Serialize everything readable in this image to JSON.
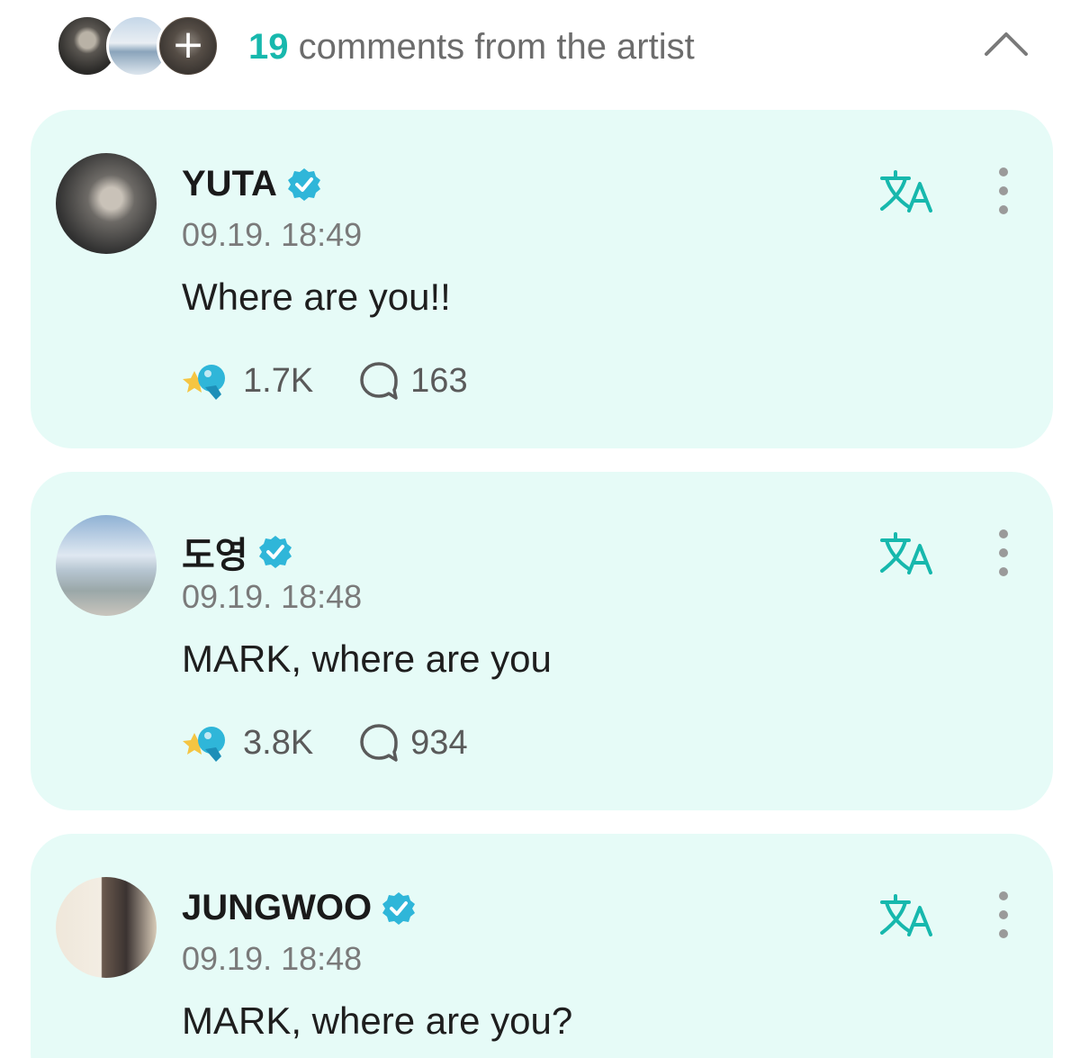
{
  "header": {
    "count": "19",
    "title_rest": " comments from the artist"
  },
  "colors": {
    "accent": "#17b8ad",
    "card_bg": "#e6fbf7",
    "verified": "#2fb6d9"
  },
  "comments": [
    {
      "author": "YUTA",
      "time": "09.19. 18:49",
      "text": "Where are you!!",
      "likes": "1.7K",
      "replies": "163"
    },
    {
      "author": "도영",
      "time": "09.19. 18:48",
      "text": "MARK, where are you",
      "likes": "3.8K",
      "replies": "934"
    },
    {
      "author": "JUNGWOO",
      "time": "09.19. 18:48",
      "text": "MARK, where are you?"
    }
  ]
}
